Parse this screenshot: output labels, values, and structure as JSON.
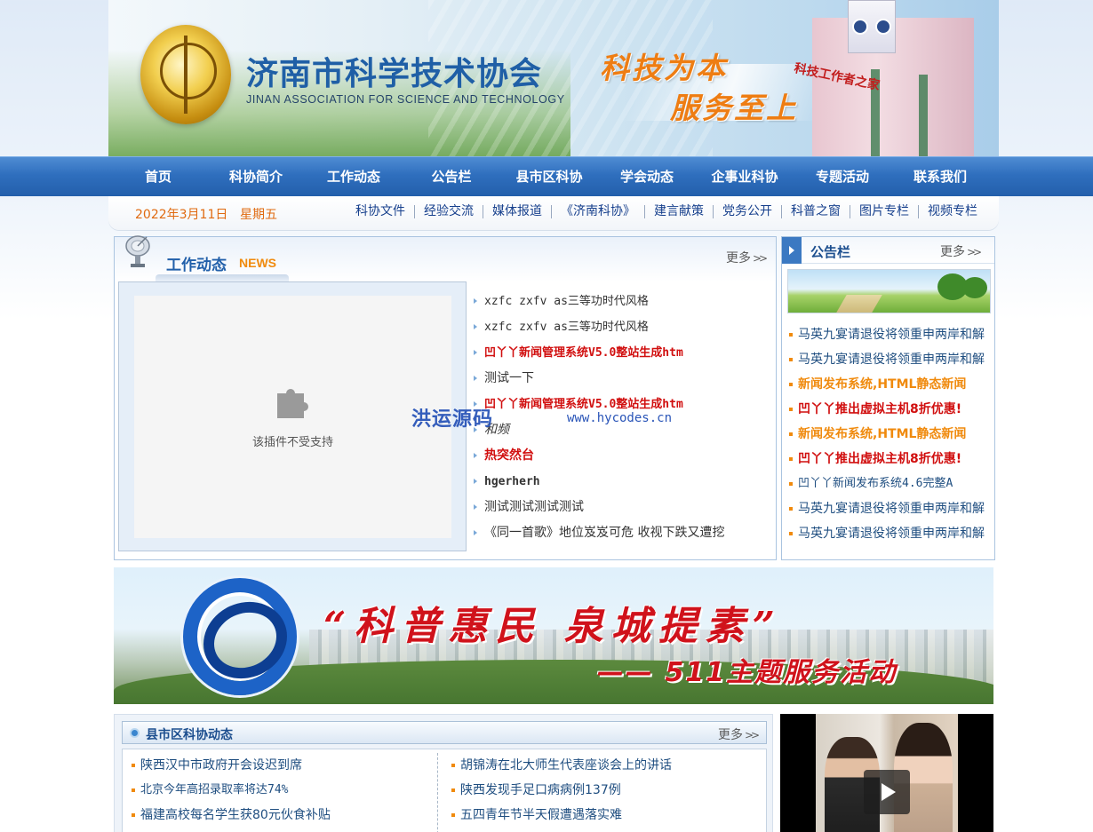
{
  "header": {
    "site_title": "济南市科学技术协会",
    "site_subtitle": "JINAN ASSOCIATION FOR SCIENCE AND TECHNOLOGY",
    "slogan_line1": "科技为本",
    "slogan_line2": "服务至上",
    "building_sign": "科技工作者之家"
  },
  "nav": {
    "items": [
      "首页",
      "科协简介",
      "工作动态",
      "公告栏",
      "县市区科协",
      "学会动态",
      "企事业科协",
      "专题活动",
      "联系我们"
    ]
  },
  "subbar": {
    "date": "2022年3月11日",
    "weekday": "星期五",
    "links": [
      "科协文件",
      "经验交流",
      "媒体报道",
      "《济南科协》",
      "建言献策",
      "党务公开",
      "科普之窗",
      "图片专栏",
      "视频专栏"
    ]
  },
  "news": {
    "title": "工作动态",
    "title_en": "NEWS",
    "more_label": "更多",
    "plugin_message": "该插件不受支持",
    "items": [
      "xzfc zxfv as三等功时代风格",
      "xzfc zxfv as三等功时代风格",
      "凹丫丫新闻管理系统V5.0整站生成htm",
      "测试一下",
      "凹丫丫新闻管理系统V5.0整站生成htm",
      "和频",
      "热突然台",
      "hgerherh",
      "测试测试测试测试",
      "《同一首歌》地位岌岌可危 收视下跌又遭挖"
    ]
  },
  "watermark": {
    "cn": "洪运源码",
    "url": "www.hycodes.cn"
  },
  "notice": {
    "title": "公告栏",
    "more_label": "更多",
    "items": [
      "马英九宴请退役将领重申两岸和解",
      "马英九宴请退役将领重申两岸和解",
      "新闻发布系统,HTML静态新闻",
      "凹丫丫推出虚拟主机8折优惠!",
      "新闻发布系统,HTML静态新闻",
      "凹丫丫推出虚拟主机8折优惠!",
      "凹丫丫新闻发布系统4.6完整A",
      "马英九宴请退役将领重申两岸和解",
      "马英九宴请退役将领重申两岸和解"
    ]
  },
  "promo": {
    "title": "“科普惠民 泉城提素”",
    "subtitle": "—— 511主题服务活动"
  },
  "county": {
    "title": "县市区科协动态",
    "more_label": "更多",
    "left_items": [
      "陕西汉中市政府开会设迟到席",
      "北京今年高招录取率将达74%",
      "福建高校每名学生获80元伙食补贴"
    ],
    "right_items": [
      "胡锦涛在北大师生代表座谈会上的讲话",
      "陕西发现手足口病病例137例",
      "五四青年节半天假遭遇落实难"
    ]
  },
  "colors": {
    "nav_blue": "#2f6fbe",
    "link_navy": "#17408d",
    "accent_orange": "#f08a0d",
    "alert_red": "#d10f0f"
  }
}
